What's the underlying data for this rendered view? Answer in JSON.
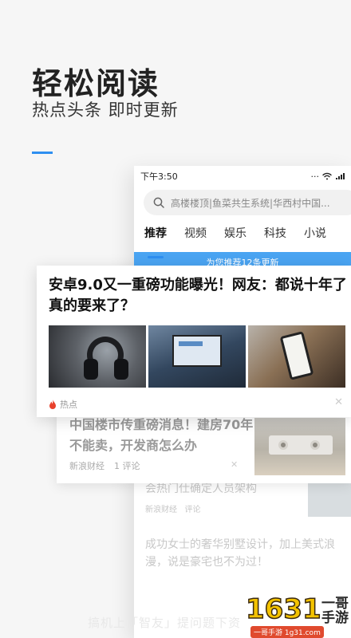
{
  "hero": {
    "title": "轻松阅读",
    "subtitle": "热点头条  即时更新"
  },
  "status_bar": {
    "time": "下午3:50"
  },
  "search": {
    "placeholder": "高楼楼顶|鱼菜共生系统|华西村中国..."
  },
  "tabs": [
    "推荐",
    "视频",
    "娱乐",
    "科技",
    "小说"
  ],
  "update_banner": "为您推荐12条更新",
  "featured_card": {
    "title": "安卓9.0又一重磅功能曝光！网友：都说十年了真的要来了？",
    "tag": "热点",
    "close": "✕"
  },
  "second_card": {
    "title": "中国楼市传重磅消息！建房70年不能卖，开发商怎么办",
    "source": "新浪财经",
    "comments": "1 评论",
    "close": "✕"
  },
  "background_items": [
    {
      "title": "会热门仕确定人员架构",
      "source": "新浪财经",
      "comments": "评论"
    },
    {
      "title": "成功女士的奢华别墅设计，加上美式浪漫，说是豪宅也不为过！",
      "source": "",
      "comments": ""
    }
  ],
  "bottom_text": "搞机上「智友」提问题下资",
  "logo": {
    "digits": "1631",
    "brand": "一哥手游",
    "url": "一哥手游 1g31.com"
  },
  "colors": {
    "accent": "#2e8ff0",
    "banner": "#4aa4f2",
    "hot": "#e8412c"
  }
}
